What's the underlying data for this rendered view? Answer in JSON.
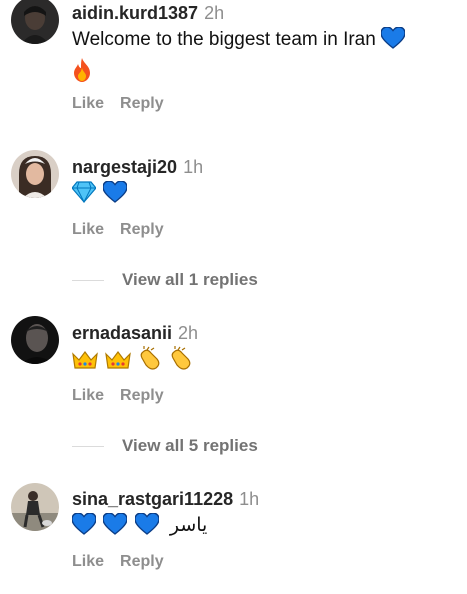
{
  "actions": {
    "like": "Like",
    "reply": "Reply"
  },
  "comments": [
    {
      "username": "aidin.kurd1387",
      "time": "2h",
      "text": "Welcome to the biggest team in Iran",
      "emoji": [
        "blue-heart",
        "fire"
      ]
    },
    {
      "username": "nargestaji20",
      "time": "1h",
      "text": "",
      "emoji": [
        "gem",
        "blue-heart"
      ],
      "view_replies": "View all 1 replies"
    },
    {
      "username": "ernadasanii",
      "time": "2h",
      "text": "",
      "emoji": [
        "crown",
        "crown",
        "clapping-hands",
        "clapping-hands"
      ],
      "view_replies": "View all 5 replies"
    },
    {
      "username": "sina_rastgari11228",
      "time": "1h",
      "text": "یاسر",
      "emoji": [
        "blue-heart",
        "blue-heart",
        "blue-heart"
      ]
    }
  ],
  "colors": {
    "username": "#262626",
    "meta": "#8e8e8e",
    "divider": "#dbdbdb",
    "blue_heart": "#1a7be8"
  }
}
